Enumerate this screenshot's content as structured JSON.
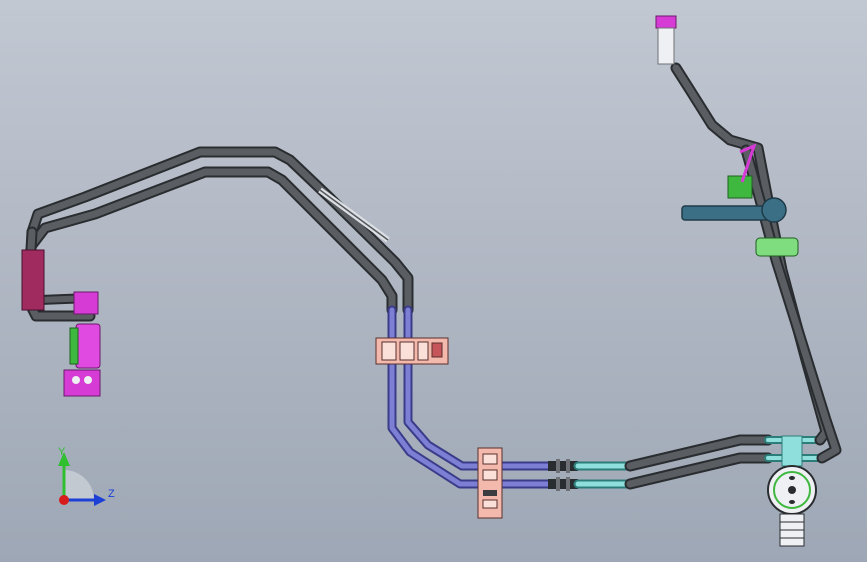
{
  "scene": {
    "background_top": "#c2c8d2",
    "background_bottom": "#9ea7b5",
    "colors": {
      "pipe_dark": "#4a4e52",
      "pipe_blue": "#6f72c4",
      "pipe_cyan": "#7fd6d4",
      "bracket_pink": "#f3b9ad",
      "connector_magenta": "#d63bd6",
      "clip_green": "#3fb83f",
      "pipe_teal": "#3b6f86"
    }
  },
  "triad": {
    "y_label": "Y",
    "z_label": "Z",
    "y_color": "#2fbf2f",
    "z_color": "#1c3fd6",
    "origin_color": "#d61c1c"
  }
}
